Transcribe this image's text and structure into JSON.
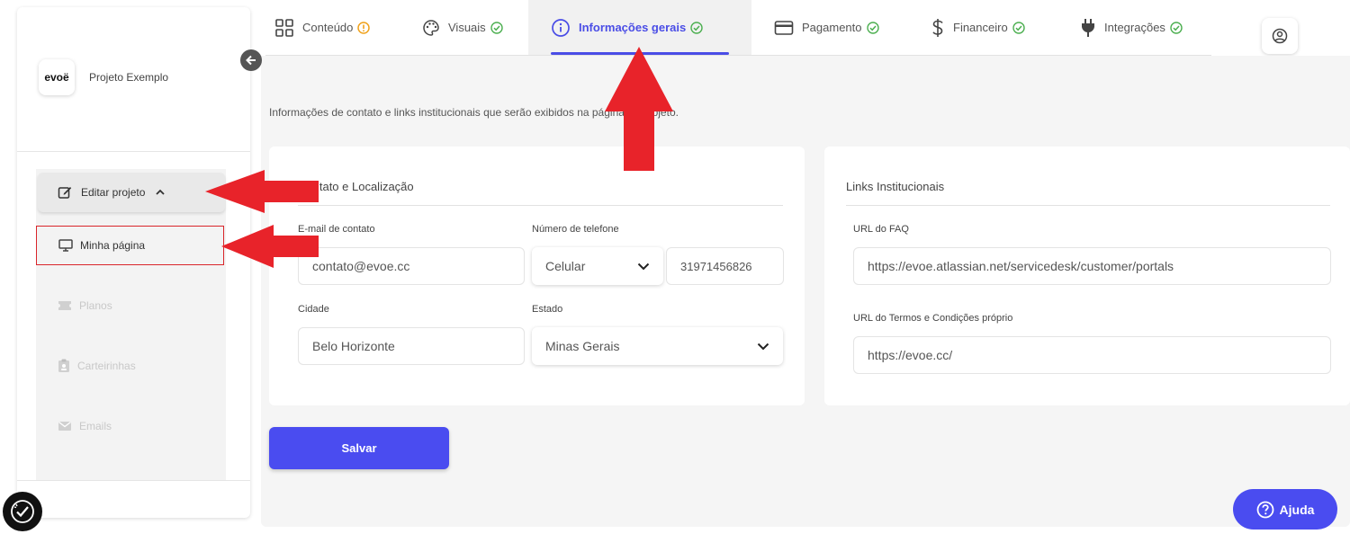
{
  "sidebar": {
    "brand_logo": "evoë",
    "project_name": "Projeto Exemplo",
    "edit_project_label": "Editar projeto",
    "items": [
      {
        "label": "Minha página",
        "state": "active"
      },
      {
        "label": "Planos",
        "state": "disabled"
      },
      {
        "label": "Carteirinhas",
        "state": "disabled"
      },
      {
        "label": "Emails",
        "state": "disabled"
      }
    ]
  },
  "tabs": [
    {
      "label": "Conteúdo",
      "icon": "grid-icon",
      "status": "warning"
    },
    {
      "label": "Visuais",
      "icon": "palette-icon",
      "status": "ok"
    },
    {
      "label": "Informações gerais",
      "icon": "info-icon",
      "status": "ok",
      "active": true
    },
    {
      "label": "Pagamento",
      "icon": "card-icon",
      "status": "ok"
    },
    {
      "label": "Financeiro",
      "icon": "dollar-icon",
      "status": "ok"
    },
    {
      "label": "Integrações",
      "icon": "plug-icon",
      "status": "ok"
    }
  ],
  "main": {
    "intro": "Informações de contato e links institucionais que serão exibidos na página do projeto.",
    "contact": {
      "title": "Contato e Localização",
      "email_label": "E-mail de contato",
      "email_value": "contato@evoe.cc",
      "phone_label": "Número de telefone",
      "phone_type": "Celular",
      "phone_value": "31971456826",
      "city_label": "Cidade",
      "city_value": "Belo Horizonte",
      "state_label": "Estado",
      "state_value": "Minas Gerais"
    },
    "links": {
      "title": "Links Institucionais",
      "faq_label": "URL do FAQ",
      "faq_value": "https://evoe.atlassian.net/servicedesk/customer/portals",
      "terms_label": "URL do Termos e Condições próprio",
      "terms_value": "https://evoe.cc/"
    },
    "save_label": "Salvar"
  },
  "help_label": "Ajuda",
  "colors": {
    "accent": "#4a4cf0",
    "ok": "#4caf50",
    "warning": "#f0a21c",
    "annotation": "#e8232a"
  }
}
